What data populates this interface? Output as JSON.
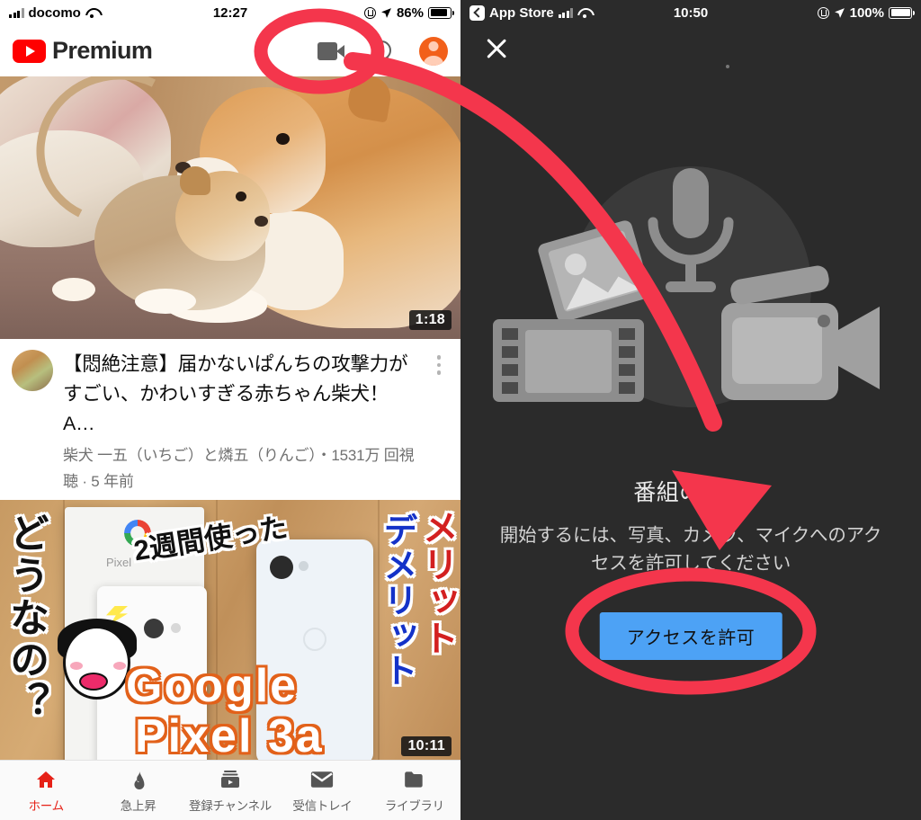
{
  "left_phone": {
    "status_bar": {
      "carrier": "docomo",
      "time": "12:27",
      "battery_percent": "86%",
      "icons": [
        "signal-bars-icon",
        "wifi-icon",
        "lock-rotation-icon",
        "location-arrow-icon",
        "battery-icon"
      ]
    },
    "header": {
      "logo_word": "Premium",
      "logo_icon": "youtube-play-icon",
      "actions": [
        {
          "name": "video-camera-icon",
          "label": "カメラ"
        },
        {
          "name": "search-icon",
          "label": "検索"
        },
        {
          "name": "account-avatar",
          "label": "アカウント"
        }
      ]
    },
    "videos": [
      {
        "duration": "1:18",
        "title": "【悶絶注意】届かないぱんちの攻撃力がすごい、かわいすぎる赤ちゃん柴犬！A…",
        "channel": "柴犬 一五（いちご）と燐五（りんご）",
        "views": "1531万 回視聴",
        "age": "5 年前",
        "meta_line": "柴犬 一五（いちご）と燐五（りんご）・1531万 回視聴 · 5 年前",
        "thumbnail_alt": "柴犬の親子"
      },
      {
        "duration": "10:11",
        "thumbnail_alt": "Google Pixel 3a レビュー",
        "overlay_texts": {
          "left_vertical": "どうなの？",
          "top_badge": "2週間使った",
          "right_red": "メリット",
          "right_blue": "デメリット",
          "right_red2": "メリット",
          "main_line1": "Google",
          "main_line2": "Pixel 3a"
        }
      }
    ],
    "bottom_nav": [
      {
        "label": "ホーム",
        "icon": "home-icon",
        "active": true
      },
      {
        "label": "急上昇",
        "icon": "flame-icon",
        "active": false
      },
      {
        "label": "登録チャンネル",
        "icon": "subscriptions-icon",
        "active": false
      },
      {
        "label": "受信トレイ",
        "icon": "inbox-envelope-icon",
        "active": false
      },
      {
        "label": "ライブラリ",
        "icon": "library-folder-icon",
        "active": false
      }
    ]
  },
  "right_phone": {
    "status_bar": {
      "back_app": "App Store",
      "time": "10:50",
      "battery_percent": "100%",
      "icons": [
        "back-chevron-icon",
        "signal-bars-icon",
        "wifi-icon",
        "lock-rotation-icon",
        "location-arrow-icon",
        "battery-icon"
      ]
    },
    "close_label": "閉じる",
    "illustration_icons": [
      "microphone-icon",
      "photo-image-icon",
      "film-strip-icon",
      "video-camera-icon"
    ],
    "title": "番組の作成",
    "description": "開始するには、写真、カメラ、マイクへのアクセスを許可してください",
    "primary_button": "アクセスを許可"
  },
  "annotations": {
    "accent_color": "#f4364c",
    "ellipse_camera_label": "カメラアイコンを囲む赤い楕円",
    "ellipse_button_label": "アクセスを許可ボタンを囲む赤い楕円",
    "arrow_label": "カメラアイコンからアクセス許可画面への赤い矢印"
  },
  "colors": {
    "youtube_red": "#ff0000",
    "active_nav": "#e62117",
    "dark_bg": "#2b2b2b",
    "button_blue": "#4da2f5",
    "annotation_red": "#f4364c"
  }
}
